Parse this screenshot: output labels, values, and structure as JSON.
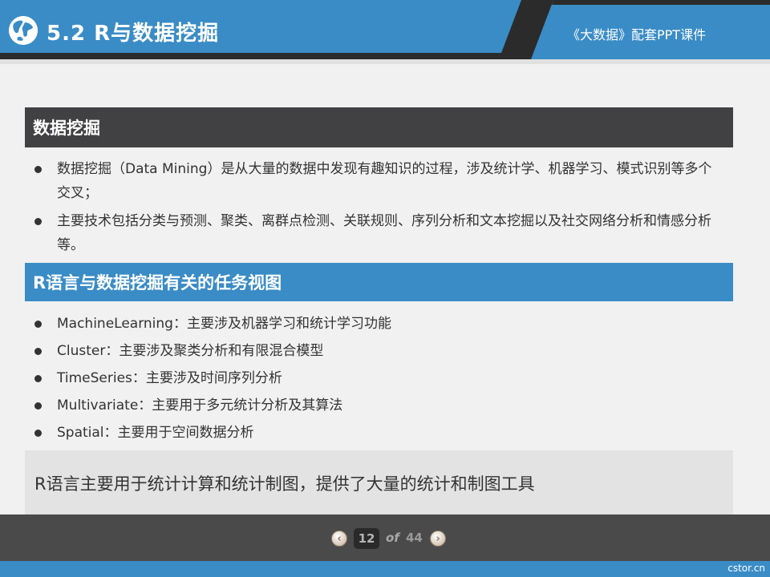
{
  "header": {
    "title": "5.2 R与数据挖掘",
    "course": "《大数据》配套PPT课件",
    "icon": "globe-icon"
  },
  "sections": [
    {
      "heading": "数据挖掘",
      "items": [
        "数据挖掘（Data Mining）是从大量的数据中发现有趣知识的过程，涉及统计学、机器学习、模式识别等多个交叉；",
        "主要技术包括分类与预测、聚类、离群点检测、关联规则、序列分析和文本挖掘以及社交网络分析和情感分析等。"
      ]
    },
    {
      "heading": "R语言与数据挖掘有关的任务视图",
      "items": [
        "MachineLearning：主要涉及机器学习和统计学习功能",
        "Cluster：主要涉及聚类分析和有限混合模型",
        "TimeSeries：主要涉及时间序列分析",
        "Multivariate：主要用于多元统计分析及其算法",
        "Spatial：主要用于空间数据分析"
      ]
    }
  ],
  "note": "R语言主要用于统计计算和统计制图，提供了大量的统计和制图工具",
  "footer": {
    "prev_glyph": "‹",
    "next_glyph": "›",
    "current_page": "12",
    "of_label": "of",
    "total_pages": "44"
  },
  "watermark": "cstor.cn",
  "colors": {
    "header_blue": "#3a8cc6",
    "dark_bar": "#414042",
    "blue_bar": "#3a8cc6",
    "footer": "#4a4a4a",
    "background": "#f1f1f1"
  }
}
